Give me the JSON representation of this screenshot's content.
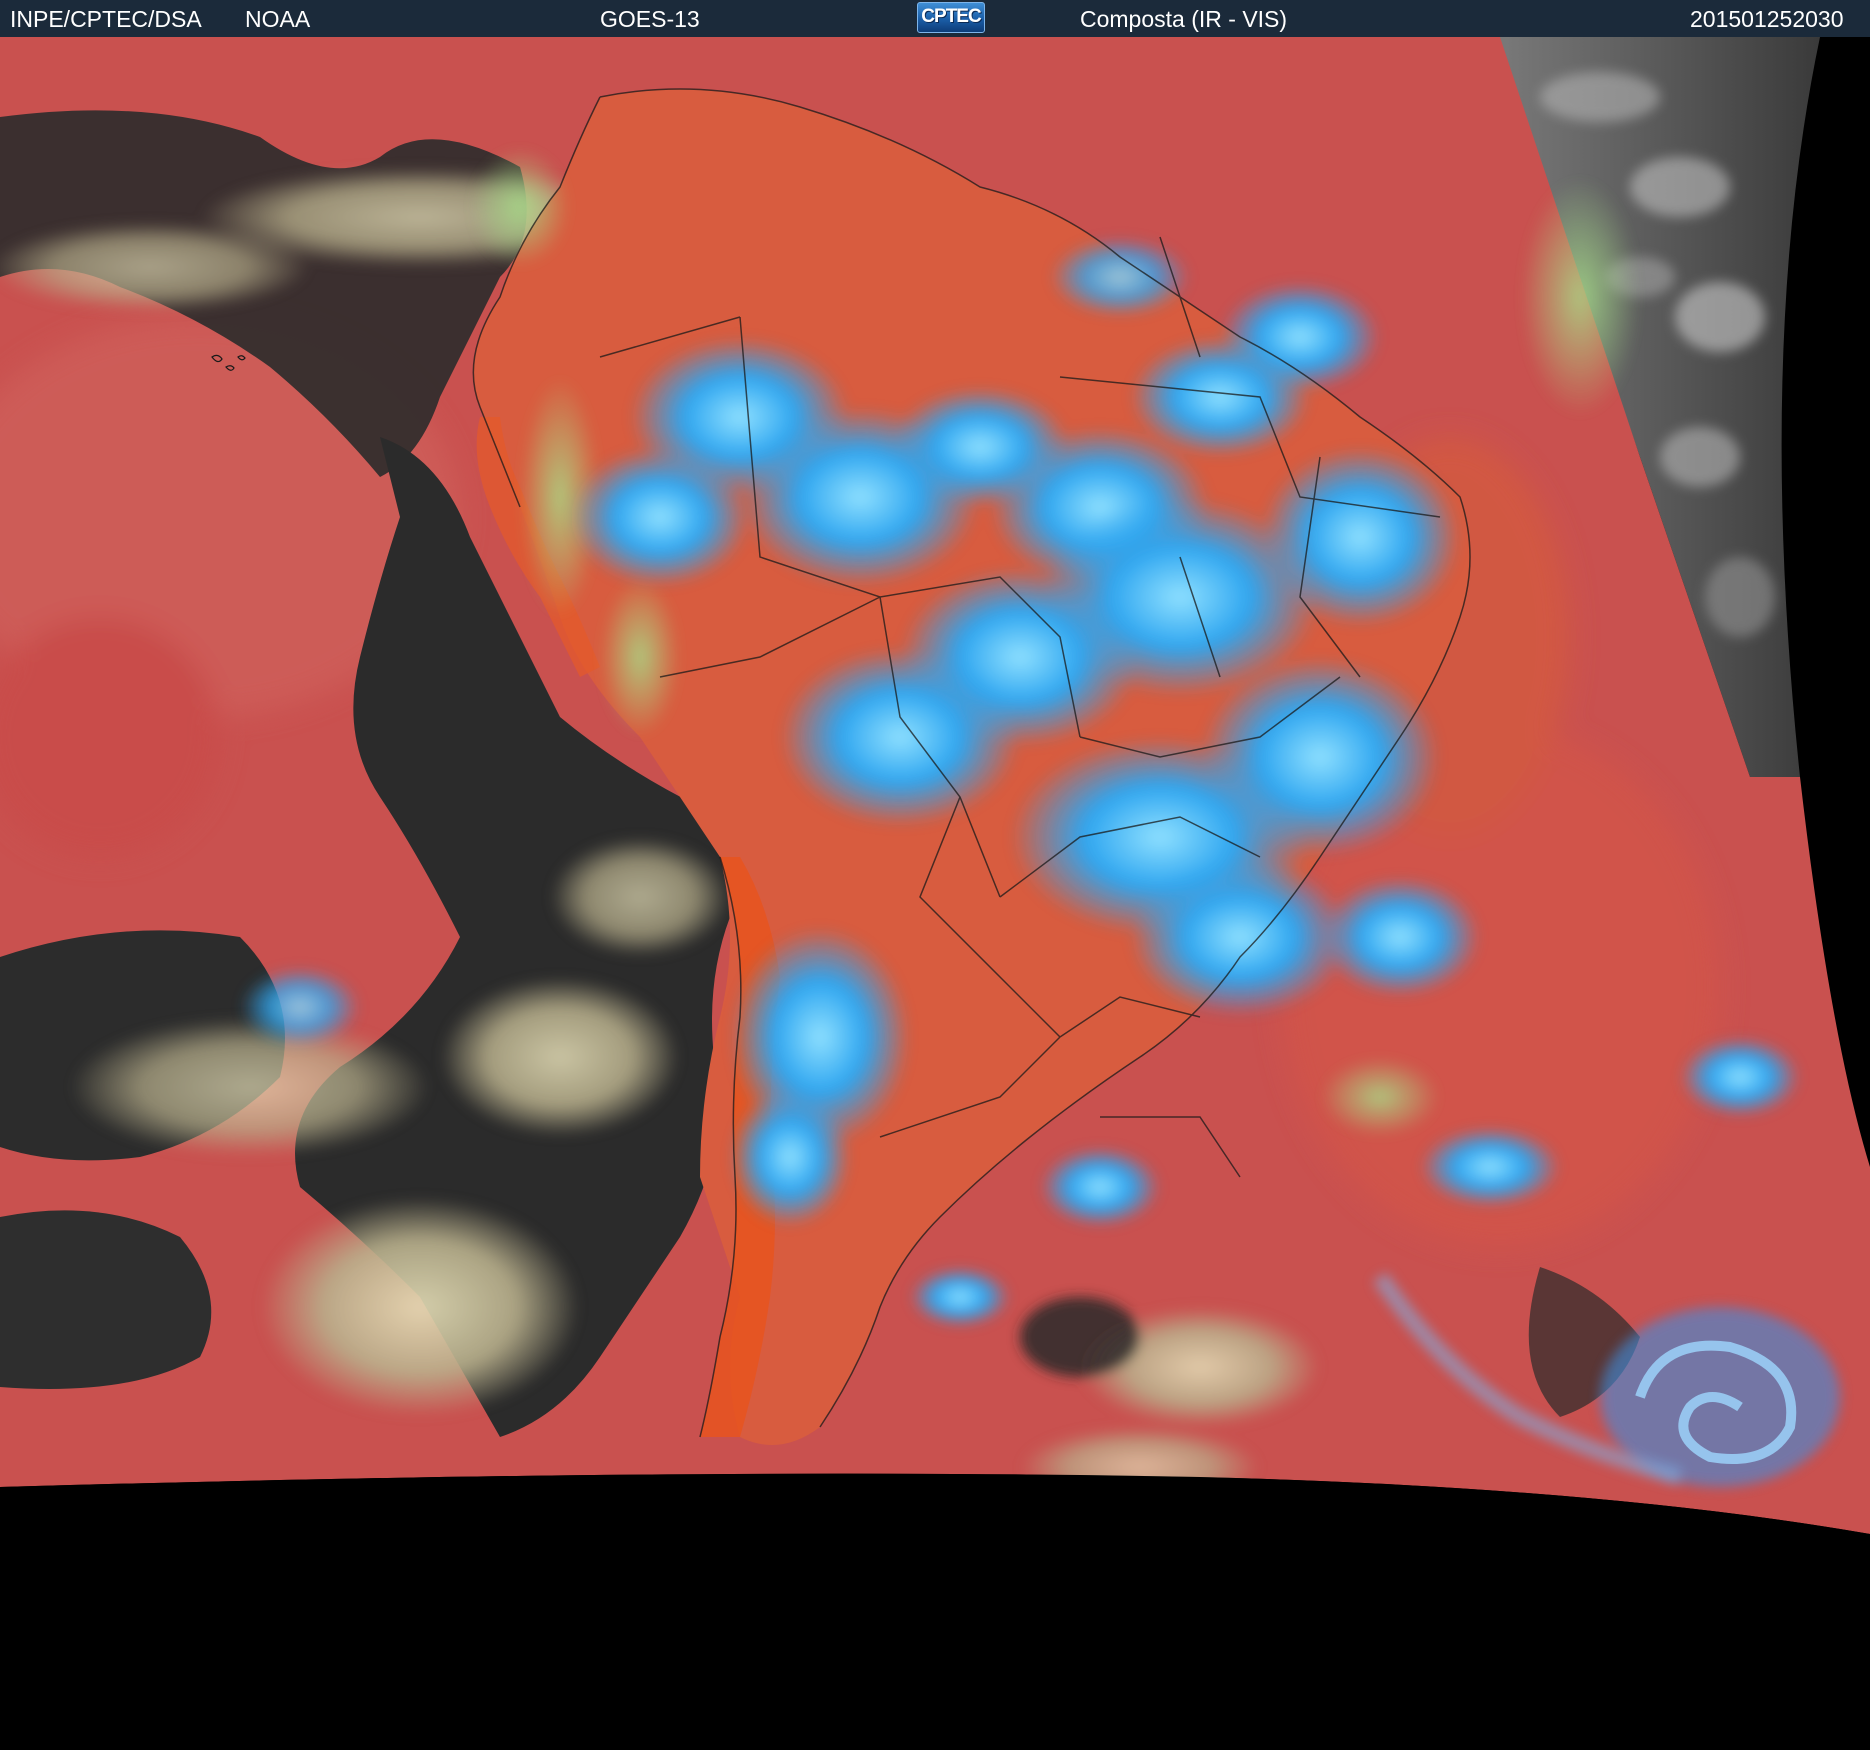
{
  "header": {
    "agency": "INPE/CPTEC/DSA",
    "partner": "NOAA",
    "satellite": "GOES-13",
    "logo_text": "CPTEC",
    "product": "Composta (IR - VIS)",
    "timestamp": "201501252030"
  },
  "colors": {
    "header_background": "#1b2a3a",
    "ocean_clear": "#c9514f",
    "land_clear": "#d95a3c",
    "low_cloud": "#2b2b2b",
    "deep_convection": "#2fa6f0",
    "cirrus": "#c7c19a",
    "visible_night": "#6a6a6a",
    "outside_disk": "#000000"
  },
  "icons": {
    "logo": "cptec-logo"
  }
}
